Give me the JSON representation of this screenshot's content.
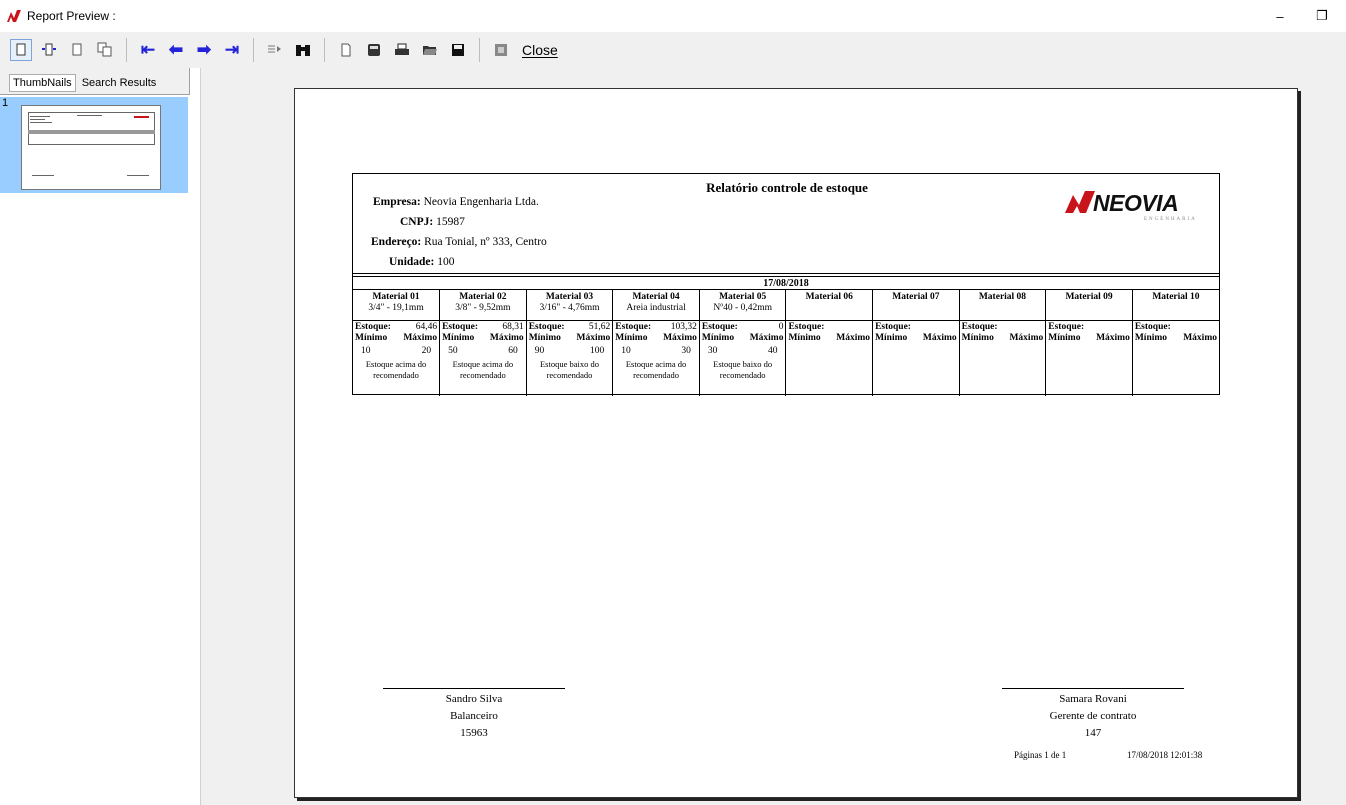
{
  "window": {
    "title": "Report Preview :",
    "minimize": "–",
    "restore": "❐"
  },
  "toolbar": {
    "close_label": "Close"
  },
  "left_panel": {
    "tabs": [
      "ThumbNails",
      "Search Results"
    ],
    "thumb_number": "1"
  },
  "report": {
    "title": "Relatório controle de estoque",
    "info": [
      {
        "label": "Empresa:",
        "value": "Neovia Engenharia Ltda."
      },
      {
        "label": "CNPJ:",
        "value": "15987"
      },
      {
        "label": "Endereço:",
        "value": "Rua Tonial, nº 333, Centro"
      },
      {
        "label": "Unidade:",
        "value": "100"
      }
    ],
    "logo": {
      "name": "NEOVIA",
      "sub": "ENGENHARIA"
    },
    "date": "17/08/2018",
    "stock_label": "Estoque:",
    "min_label": "Mínimo",
    "max_label": "Máximo",
    "materials": [
      {
        "name": "Material 01",
        "spec": "3/4\" - 19,1mm",
        "stock": "64,46",
        "min": "10",
        "max": "20",
        "status_line1": "Estoque acima do",
        "status_line2": "recomendado"
      },
      {
        "name": "Material 02",
        "spec": "3/8\" - 9,52mm",
        "stock": "68,31",
        "min": "50",
        "max": "60",
        "status_line1": "Estoque acima do",
        "status_line2": "recomendado"
      },
      {
        "name": "Material 03",
        "spec": "3/16\" - 4,76mm",
        "stock": "51,62",
        "min": "90",
        "max": "100",
        "status_line1": "Estoque baixo do",
        "status_line2": "recomendado"
      },
      {
        "name": "Material 04",
        "spec": "Areia industrial",
        "stock": "103,32",
        "min": "10",
        "max": "30",
        "status_line1": "Estoque acima do",
        "status_line2": "recomendado"
      },
      {
        "name": "Material 05",
        "spec": "Nº40 - 0,42mm",
        "stock": "0",
        "min": "30",
        "max": "40",
        "status_line1": "Estoque baixo do",
        "status_line2": "recomendado"
      },
      {
        "name": "Material 06",
        "spec": "",
        "stock": "",
        "min": "",
        "max": "",
        "status_line1": "",
        "status_line2": ""
      },
      {
        "name": "Material 07",
        "spec": "",
        "stock": "",
        "min": "",
        "max": "",
        "status_line1": "",
        "status_line2": ""
      },
      {
        "name": "Material 08",
        "spec": "",
        "stock": "",
        "min": "",
        "max": "",
        "status_line1": "",
        "status_line2": ""
      },
      {
        "name": "Material 09",
        "spec": "",
        "stock": "",
        "min": "",
        "max": "",
        "status_line1": "",
        "status_line2": ""
      },
      {
        "name": "Material 10",
        "spec": "",
        "stock": "",
        "min": "",
        "max": "",
        "status_line1": "",
        "status_line2": ""
      }
    ],
    "signatures": [
      {
        "name": "Sandro Silva",
        "role": "Balanceiro",
        "id": "15963"
      },
      {
        "name": "Samara Rovani",
        "role": "Gerente de contrato",
        "id": "147"
      }
    ],
    "footer": {
      "pages": "Páginas  1   de  1",
      "datetime": "17/08/2018 12:01:38"
    }
  }
}
